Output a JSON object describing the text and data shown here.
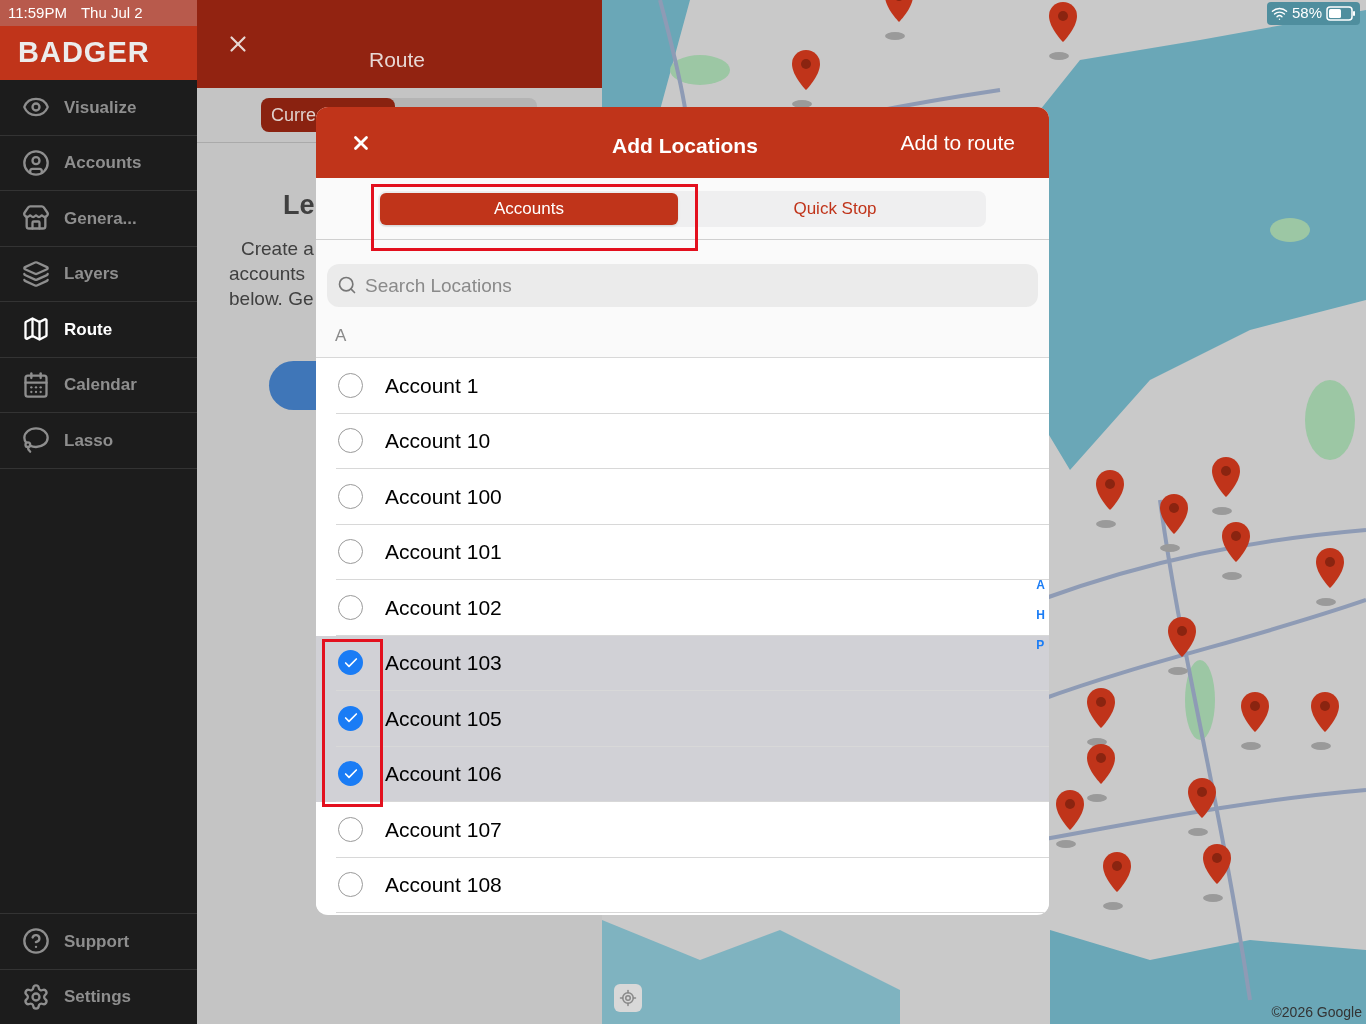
{
  "status_bar": {
    "time": "11:59PM",
    "date": "Thu Jul 2",
    "battery": "58%"
  },
  "sidebar": {
    "logo": "BADGER",
    "items": [
      {
        "label": "Visualize",
        "selected": false
      },
      {
        "label": "Accounts",
        "selected": false
      },
      {
        "label": "Genera...",
        "selected": false
      },
      {
        "label": "Layers",
        "selected": false
      },
      {
        "label": "Route",
        "selected": true
      },
      {
        "label": "Calendar",
        "selected": false
      },
      {
        "label": "Lasso",
        "selected": false
      }
    ],
    "footer_items": [
      {
        "label": "Support"
      },
      {
        "label": "Settings"
      }
    ]
  },
  "route_panel": {
    "title": "Route",
    "segment": "Curre",
    "heading": "Le",
    "body_lines": [
      "Create a",
      "accounts",
      "below. Ge"
    ]
  },
  "map": {
    "attribution": "©2026 Google"
  },
  "modal": {
    "title": "Add Locations",
    "action": "Add to route",
    "tabs": [
      {
        "label": "Accounts",
        "selected": true
      },
      {
        "label": "Quick Stop",
        "selected": false
      }
    ],
    "search": {
      "placeholder": "Search Locations"
    },
    "section": "A",
    "rows": [
      {
        "label": "Account 1",
        "checked": false
      },
      {
        "label": "Account 10",
        "checked": false
      },
      {
        "label": "Account 100",
        "checked": false
      },
      {
        "label": "Account 101",
        "checked": false
      },
      {
        "label": "Account 102",
        "checked": false
      },
      {
        "label": "Account 103",
        "checked": true
      },
      {
        "label": "Account 105",
        "checked": true
      },
      {
        "label": "Account 106",
        "checked": true
      },
      {
        "label": "Account 107",
        "checked": false
      },
      {
        "label": "Account 108",
        "checked": false
      }
    ],
    "index_letters": [
      "A",
      "H",
      "P"
    ]
  }
}
